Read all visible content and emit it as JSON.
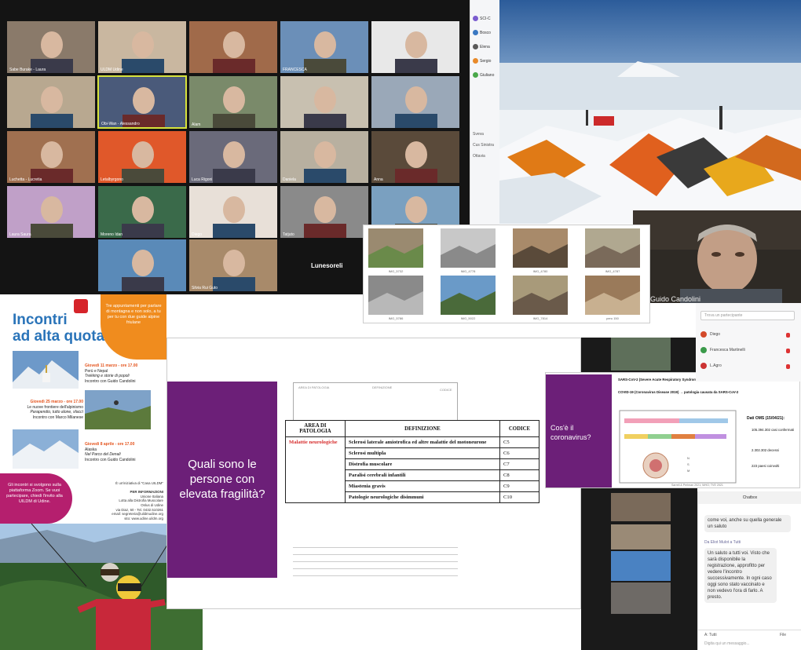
{
  "zoom_gallery": {
    "participants": [
      "Sabe Burake - Laura",
      "ULDM Udine",
      "",
      "FRANCESCA",
      "",
      "",
      "Obi-Wan - Alessandro",
      "Alam",
      "",
      "",
      "Luchetta - Lucretia",
      "Letalbyrgono",
      "Luca Rigoni",
      "Daniela",
      "Anna",
      "Laura Saura",
      "Moreno Idan",
      "Diego",
      "Tatjuto",
      "",
      "",
      "Silvia Rui Guto"
    ],
    "self_view": "Lunesoreli"
  },
  "strip": {
    "rows": [
      "SCI-C",
      "Bosco",
      "Elena",
      "Sergio",
      "Giuliano"
    ],
    "other": [
      "Sveva",
      "Cus Sinistra",
      "Ottavia"
    ]
  },
  "guido": {
    "name": "Guido Candolini"
  },
  "photo_grid": {
    "captions": [
      "IMG_5732",
      "IMG_4778",
      "IMG_4780",
      "IMG_4787",
      "IMG_5786",
      "IMG_5022",
      "IMG_7814",
      "peru 150"
    ]
  },
  "poster": {
    "title_line1": "Incontri",
    "title_line2": "ad alta quota",
    "orange_text": "Tre appuntamenti per parlare di montagna e non solo, a tu per tu con due guide alpine friulane",
    "events": [
      {
        "date": "Giovedì 11 marzo - ore 17.00",
        "place": "Perù e Nepal",
        "sub": "Trekking e storie di popoli",
        "who": "Incontro con Guido Candolini"
      },
      {
        "date": "Giovedì 25 marzo - ore 17.00",
        "place": "Le nuove frontiere dell'alpinismo",
        "sub": "Parapendio, tutto alone, sfaccì",
        "who": "Incontro con Marco Milanese"
      },
      {
        "date": "Giovedì 8 aprile - ore 17.00",
        "place": "Alaska",
        "sub": "Nel Parco del Denali",
        "who": "Incontro con Guido Candolini"
      }
    ],
    "pink_text": "Gli incontri si svolgono sulla piattaforma Zoom. Se vuoi partecipare, chiedi l'invito alla UILDM di Udine.",
    "info_lines": [
      "È un'iniziativa di \"Casa UILDM\"",
      "",
      "PER INFORMAZIONI",
      "Unione Italiana",
      "Lotta alla Distrofia Muscolare",
      "Onlus di Udine",
      "via Diaz, 60 - Tel. 0432.510261",
      "email: segreteria@uildmudine.org",
      "sito: www.udine.uildm.org"
    ]
  },
  "fragility_slide": {
    "question": "Quali sono le persone con elevata fragilità?",
    "bg_headers": [
      "AREA DI PATOLOGIA",
      "DEFINIZIONE",
      "CODICE"
    ],
    "headers": [
      "AREA DI PATOLOGIA",
      "DEFINIZIONE",
      "CODICE"
    ],
    "category": "Malattie neurologiche",
    "rows": [
      {
        "def": "Sclerosi laterale amiotrofica ed altre malattie del motoneurone",
        "code": "C5"
      },
      {
        "def": "Sclerosi multipla",
        "code": "C6"
      },
      {
        "def": "Distrofia muscolare",
        "code": "C7"
      },
      {
        "def": "Paralisi cerebrali infantili",
        "code": "C8"
      },
      {
        "def": "Miastenia gravis",
        "code": "C9"
      },
      {
        "def": "Patologie neurologiche disimmuni",
        "code": "C10"
      }
    ]
  },
  "cov_slide": {
    "question": "Cos'è il coronavirus?",
    "line1": "SARS-CoV-2 (Severe Acute Respiratory Syndrome Coronavirus 2) → agente patogeno",
    "line2": "COVID-19 (Coronavirus Disease 2019) → patologia causata da SARS-CoV-2",
    "oms_title": "Dati OMS (15/04/21):",
    "stats": [
      "105.394.302 casi confermati",
      "2.302.302 decessi",
      "223 paesi coinvolti"
    ],
    "source": "Sarrell & Perlman 2021; WHO; TVE 2021"
  },
  "participant_list": {
    "search_placeholder": "Trova un partecipante",
    "names": [
      "Diego",
      "Francesca Martinelli",
      "L.Agro"
    ]
  },
  "chat": {
    "title": "Chatbox",
    "msg1": "come voi, anche su quella generale un saluto",
    "from": "Da Eliot Mulot a Tutti",
    "msg2": "Un saluto a tutti voi. Visto che sarà disponibile la registrazione, approfitto per vedere l'incontro successivamente. In ogni caso oggi sono stato vaccinato e non vedevo l'ora di farlo. A presto.",
    "to_label": "A: Tutti",
    "file_label": "File",
    "input_placeholder": "Digita qui un messaggio..."
  },
  "colors": {
    "zoom_bg": "#141414",
    "purple": "#6c1f78",
    "poster_blue": "#2a74b9",
    "poster_orange": "#f08c1e",
    "poster_pink": "#b51f6e",
    "active_speaker": "#d7e33b"
  }
}
